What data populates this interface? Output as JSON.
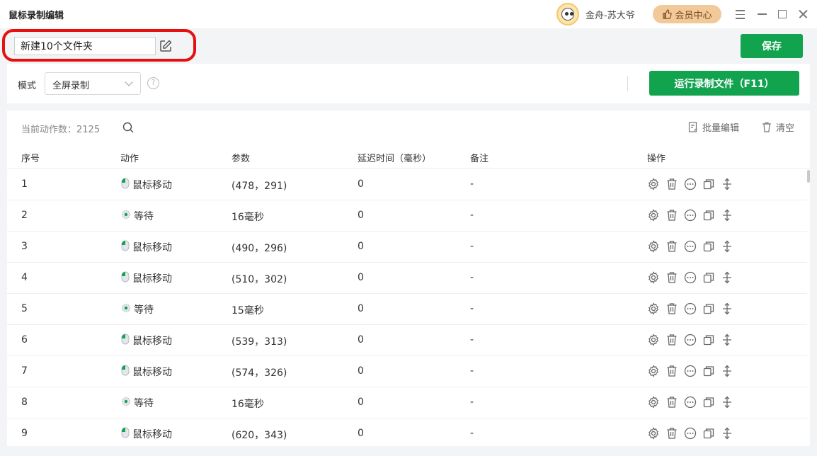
{
  "app_title": "鼠标录制编辑",
  "user": {
    "name": "金舟-苏大爷",
    "vip_label": "会员中心"
  },
  "name_field": {
    "value": "新建10个文件夹"
  },
  "save_label": "保存",
  "mode": {
    "label": "模式",
    "selected": "全屏录制",
    "help": "?"
  },
  "run_label": "运行录制文件（F11）",
  "table": {
    "count_text": "当前动作数：2125",
    "batch_label": "批量编辑",
    "clear_label": "清空",
    "headers": [
      "序号",
      "动作",
      "参数",
      "延迟时间（毫秒）",
      "备注",
      "操作"
    ],
    "rows": [
      {
        "no": "1",
        "action": "鼠标移动",
        "type": "mouse",
        "param": "(478，291)",
        "delay": "0",
        "note": "-"
      },
      {
        "no": "2",
        "action": "等待",
        "type": "wait",
        "param": "16毫秒",
        "delay": "0",
        "note": "-"
      },
      {
        "no": "3",
        "action": "鼠标移动",
        "type": "mouse",
        "param": "(490，296)",
        "delay": "0",
        "note": "-"
      },
      {
        "no": "4",
        "action": "鼠标移动",
        "type": "mouse",
        "param": "(510，302)",
        "delay": "0",
        "note": "-"
      },
      {
        "no": "5",
        "action": "等待",
        "type": "wait",
        "param": "15毫秒",
        "delay": "0",
        "note": "-"
      },
      {
        "no": "6",
        "action": "鼠标移动",
        "type": "mouse",
        "param": "(539，313)",
        "delay": "0",
        "note": "-"
      },
      {
        "no": "7",
        "action": "鼠标移动",
        "type": "mouse",
        "param": "(574，326)",
        "delay": "0",
        "note": "-"
      },
      {
        "no": "8",
        "action": "等待",
        "type": "wait",
        "param": "16毫秒",
        "delay": "0",
        "note": "-"
      },
      {
        "no": "9",
        "action": "鼠标移动",
        "type": "mouse",
        "param": "(620，343)",
        "delay": "0",
        "note": "-"
      }
    ]
  },
  "colors": {
    "primary_green": "#12a34f",
    "highlight_red": "#e51010",
    "vip_gold": "#f2c999"
  }
}
